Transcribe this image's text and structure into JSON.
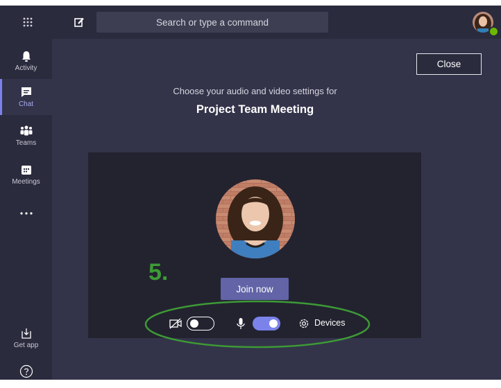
{
  "topbar": {
    "search_placeholder": "Search or type a command"
  },
  "rail": {
    "items": [
      {
        "label": "Activity",
        "icon": "bell-icon"
      },
      {
        "label": "Chat",
        "icon": "chat-icon",
        "active": true
      },
      {
        "label": "Teams",
        "icon": "teams-icon"
      },
      {
        "label": "Meetings",
        "icon": "calendar-icon"
      },
      {
        "label": "",
        "icon": "more-icon"
      }
    ],
    "bottom": [
      {
        "label": "Get app",
        "icon": "download-icon"
      },
      {
        "label": "",
        "icon": "help-icon"
      }
    ]
  },
  "main": {
    "close_label": "Close",
    "subtitle": "Choose your audio and video settings for",
    "meeting_title": "Project Team Meeting",
    "join_label": "Join now",
    "annotation_step": "5.",
    "controls": {
      "camera_on": false,
      "mic_on": true,
      "devices_label": "Devices"
    }
  },
  "colors": {
    "accent": "#6264a7",
    "toggle_on": "#7b83eb",
    "annotation_green": "#3d9b35",
    "presence": "#6bb700"
  }
}
